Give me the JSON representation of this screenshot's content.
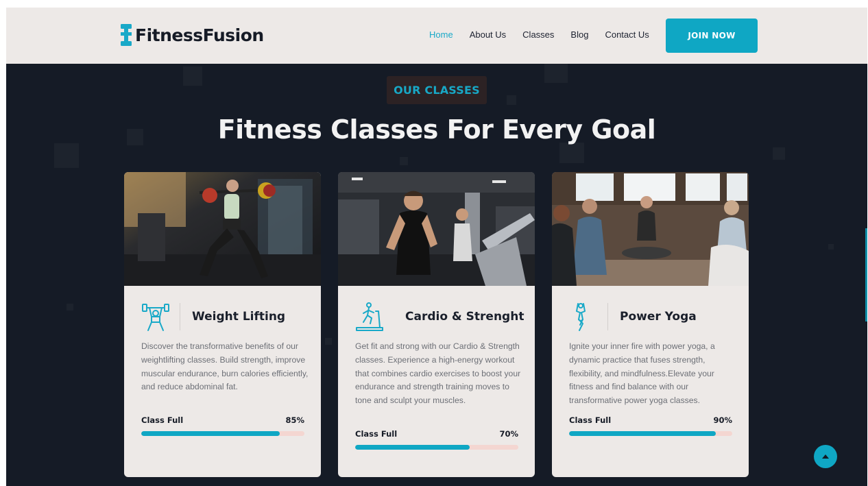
{
  "brand": {
    "name": "FitnessFusion",
    "logo_icon": "dumbbell-icon"
  },
  "nav": {
    "items": [
      {
        "label": "Home",
        "active": true
      },
      {
        "label": "About Us",
        "active": false
      },
      {
        "label": "Classes",
        "active": false
      },
      {
        "label": "Blog",
        "active": false
      },
      {
        "label": "Contact Us",
        "active": false
      }
    ],
    "cta_label": "JOIN NOW"
  },
  "section": {
    "badge": "OUR CLASSES",
    "title": "Fitness Classes For Every Goal"
  },
  "cards": [
    {
      "title": "Weight Lifting",
      "icon": "weightlifter-icon",
      "description": "Discover the transformative benefits of our weightlifting classes. Build strength, improve muscular endurance, burn calories efficiently, and reduce abdominal fat.",
      "progress_label": "Class Full",
      "progress_text": "85%",
      "progress_value": 85
    },
    {
      "title": "Cardio & Strenght",
      "icon": "treadmill-icon",
      "description": "Get fit and strong with our Cardio & Strength classes. Experience a high-energy workout that combines cardio exercises to boost your endurance and strength training moves to tone and sculpt your muscles.",
      "progress_label": "Class Full",
      "progress_text": "70%",
      "progress_value": 70
    },
    {
      "title": "Power Yoga",
      "icon": "yoga-pose-icon",
      "description": "Ignite your inner fire with power yoga, a dynamic practice that fuses strength, flexibility, and mindfulness.Elevate your fitness and find balance with our transformative power yoga classes.",
      "progress_label": "Class Full",
      "progress_text": "90%",
      "progress_value": 90
    }
  ],
  "colors": {
    "accent": "#0fa7c4",
    "dark_bg": "#151b26",
    "card_bg": "#ede9e7",
    "track": "#f4d6d1"
  },
  "scroll_top_icon": "arrow-up-icon"
}
